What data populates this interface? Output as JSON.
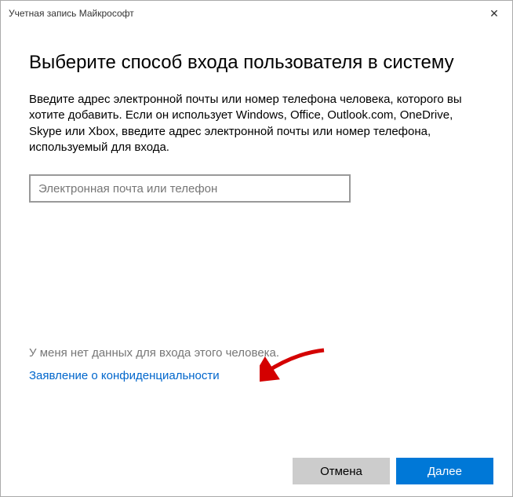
{
  "window": {
    "title": "Учетная запись Майкрософт"
  },
  "main": {
    "heading": "Выберите способ входа пользователя в систему",
    "description": "Введите адрес электронной почты или номер телефона человека, которого вы хотите добавить. Если он использует Windows, Office, Outlook.com, OneDrive, Skype или Xbox, введите адрес электронной почты или номер телефона, используемый для входа.",
    "input_placeholder": "Электронная почта или телефон",
    "input_value": ""
  },
  "links": {
    "no_data_text": "У меня нет данных для входа этого человека.",
    "privacy_label": "Заявление о конфиденциальности"
  },
  "buttons": {
    "cancel": "Отмена",
    "next": "Далее"
  },
  "colors": {
    "accent": "#0078d7",
    "link": "#0066cc",
    "arrow": "#d40000"
  }
}
